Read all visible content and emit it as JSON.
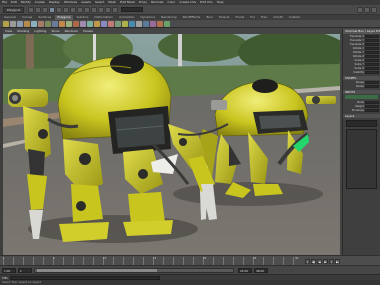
{
  "menu": {
    "items": [
      "File",
      "Edit",
      "Modify",
      "Create",
      "Display",
      "Windows",
      "Assets",
      "Select",
      "Mesh",
      "Edit Mesh",
      "Proxy",
      "Normals",
      "Color",
      "Create UVs",
      "Edit UVs",
      "Help"
    ]
  },
  "status": {
    "mode": "Polygons"
  },
  "shelf": {
    "tabs": [
      "General",
      "Curves",
      "Surfaces",
      "Polygons",
      "Subdivs",
      "Deformation",
      "Animation",
      "Dynamics",
      "Rendering",
      "PaintEffects",
      "Toon",
      "Muscle",
      "Fluids",
      "Fur",
      "Hair",
      "nCloth",
      "Custom"
    ],
    "active_tab": "Polygons"
  },
  "viewport": {
    "menu": [
      "View",
      "Shading",
      "Lighting",
      "Show",
      "Renderer",
      "Panels"
    ]
  },
  "attribute_panel": {
    "title": "Channel Box / Layer Editor",
    "section": "SHAPES",
    "section2": "INPUTS",
    "layers_label": "Layers"
  },
  "timeline": {
    "start_label": "1",
    "labels": [
      "1",
      "5",
      "10",
      "15",
      "20",
      "25",
      "30"
    ],
    "range_start": "1.00",
    "range_end": "24.00",
    "anim_end": "48.00"
  },
  "command": {
    "label": "MEL"
  },
  "help": {
    "text": "Select Tool: select an object"
  },
  "colors": {
    "robot_body": "#c9c51f",
    "robot_dark": "#2a2a28",
    "accent_green": "#23d66b"
  }
}
